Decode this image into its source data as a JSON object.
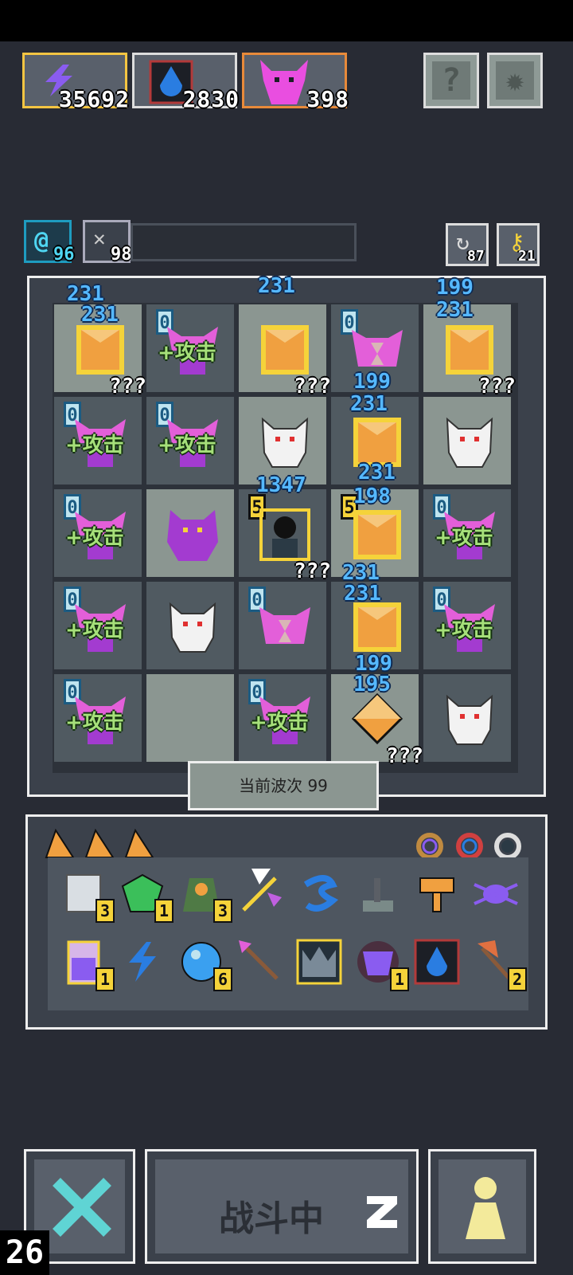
{
  "resources": {
    "energy": {
      "value": "35692",
      "icon": "lightning-icon",
      "color": "#8a5cf0"
    },
    "mana": {
      "value": "2830",
      "icon": "blue-drop-icon",
      "color": "#2a7de1"
    },
    "enemy": {
      "value": "398",
      "icon": "pink-demon-icon",
      "color": "#e94ee0"
    }
  },
  "top_buttons": {
    "help_label": "?",
    "settings_icon": "gear-icon"
  },
  "sub_stats": {
    "swirl_value": "96",
    "bat_value": "98",
    "rotate_value": "87",
    "key_value": "21"
  },
  "grid_labels": {
    "attack_tag": "+攻击",
    "unknown": "???",
    "zero": "0",
    "five": "5"
  },
  "damage_numbers": [
    "231",
    "231",
    "231",
    "199",
    "231",
    "199",
    "231",
    "1347",
    "231",
    "198",
    "231",
    "231",
    "199",
    "195"
  ],
  "wave": {
    "label": "当前波次 99"
  },
  "inventory": {
    "items": [
      {
        "icon": "scroll-icon",
        "qty": "3"
      },
      {
        "icon": "green-gem-icon",
        "qty": "1"
      },
      {
        "icon": "hooded-figure-icon",
        "qty": "3"
      },
      {
        "icon": "magic-wand-icon",
        "qty": ""
      },
      {
        "icon": "blue-swirl-icon",
        "qty": ""
      },
      {
        "icon": "lever-icon",
        "qty": ""
      },
      {
        "icon": "key-icon",
        "qty": ""
      },
      {
        "icon": "purple-spider-icon",
        "qty": ""
      },
      {
        "icon": "potion-jar-icon",
        "qty": "1"
      },
      {
        "icon": "blue-bolt-icon",
        "qty": ""
      },
      {
        "icon": "blue-orb-icon",
        "qty": "6"
      },
      {
        "icon": "arrow-icon",
        "qty": ""
      },
      {
        "icon": "crown-icon",
        "qty": ""
      },
      {
        "icon": "demon-face-icon",
        "qty": "1"
      },
      {
        "icon": "fire-card-icon",
        "qty": ""
      },
      {
        "icon": "axe-icon",
        "qty": "2"
      }
    ]
  },
  "bottom": {
    "battle_label": "战斗中",
    "corner_number": "26"
  }
}
